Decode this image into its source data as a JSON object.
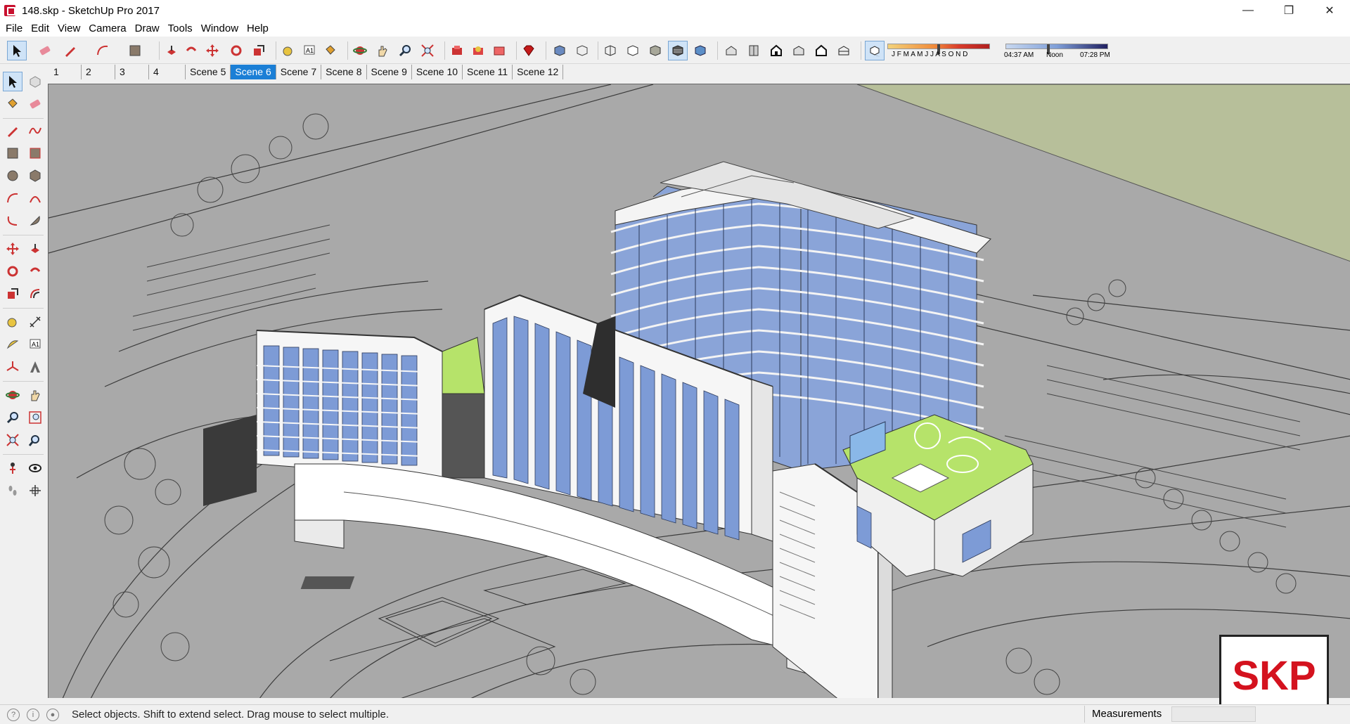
{
  "window": {
    "title": "148.skp - SketchUp Pro 2017",
    "minimize_glyph": "—",
    "maximize_glyph": "❐",
    "close_glyph": "✕"
  },
  "menu": [
    "File",
    "Edit",
    "View",
    "Camera",
    "Draw",
    "Tools",
    "Window",
    "Help"
  ],
  "shadows": {
    "months": "J F M A M J J A S O N D",
    "time_start": "04:37 AM",
    "time_mid": "Noon",
    "time_end": "07:28 PM"
  },
  "scenes": {
    "tabs": [
      "1",
      "2",
      "3",
      "4",
      "Scene 5",
      "Scene 6",
      "Scene 7",
      "Scene 8",
      "Scene 9",
      "Scene 10",
      "Scene 11",
      "Scene 12"
    ],
    "active": "Scene 6"
  },
  "status": {
    "hint": "Select objects. Shift to extend select. Drag mouse to select multiple.",
    "measurements_label": "Measurements",
    "measurements_value": ""
  },
  "watermark": "SKP",
  "colors": {
    "active_tab": "#1b7fd6",
    "glass": "#7d9bd6",
    "roof_green": "#b6e36a",
    "ground": "#a9a9a9",
    "lawn": "#b7bf9a"
  }
}
